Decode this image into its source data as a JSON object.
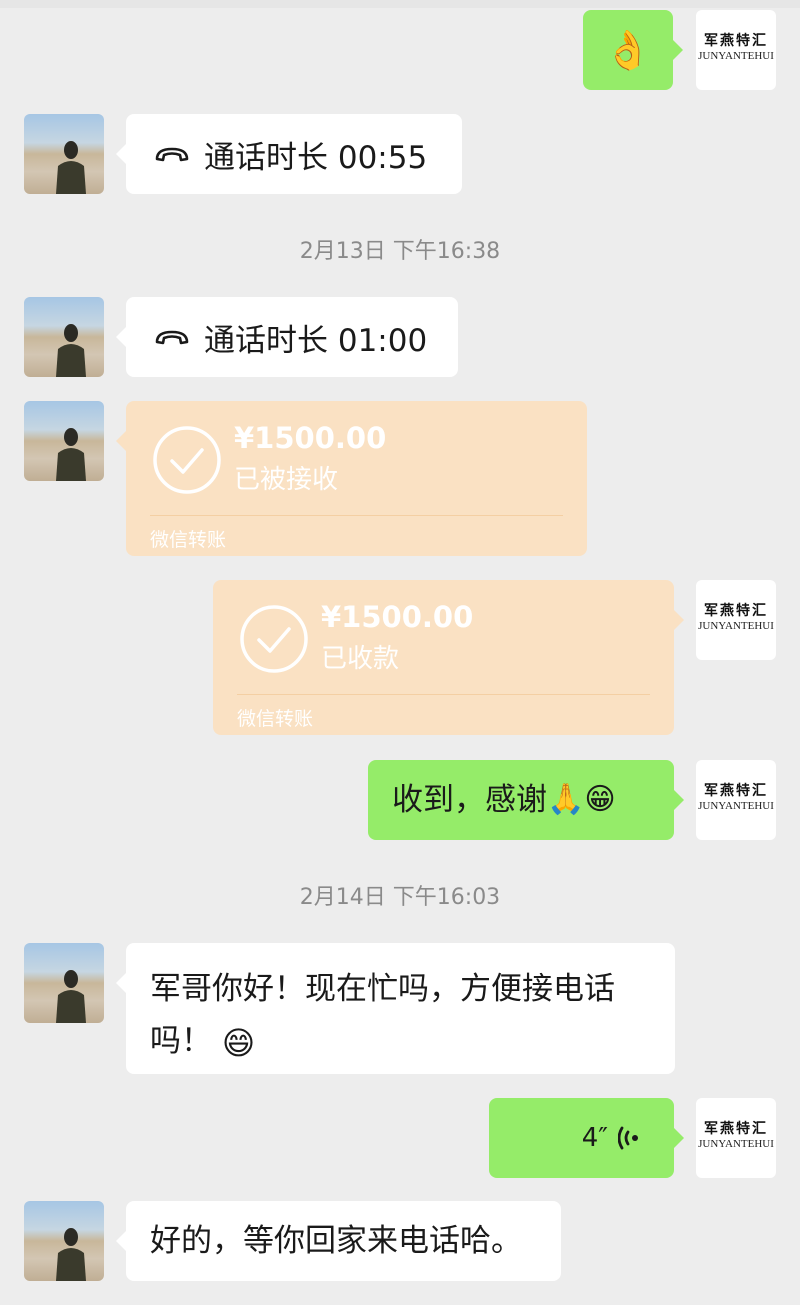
{
  "timestamps": [
    "2月13日 下午16:38",
    "2月14日 下午16:03"
  ],
  "logo": {
    "cn": "军燕特汇",
    "en": "JUNYANTEHUI"
  },
  "messages": {
    "ok_emoji": "👌",
    "call_1": {
      "label": "通话时长 00:55"
    },
    "call_2": {
      "label": "通话时长 01:00"
    },
    "transfer_1": {
      "amount": "¥1500.00",
      "status": "已被接收",
      "label": "微信转账"
    },
    "transfer_2": {
      "amount": "¥1500.00",
      "status": "已收款",
      "label": "微信转账"
    },
    "thanks": {
      "text": "收到，感谢",
      "emojis": [
        "🙏",
        "😁"
      ]
    },
    "ask": {
      "text": "军哥你好！现在忙吗，方便接电话吗！",
      "emoji": "😄"
    },
    "voice": {
      "duration": "4″"
    },
    "reply": {
      "text": "好的，等你回家来电话哈。"
    }
  },
  "icons": {
    "phone": "phone-hangup-icon",
    "check": "check-circle-icon",
    "voice": "voice-wave-icon"
  },
  "colors": {
    "background": "#ededed",
    "bubble_self": "#95ec69",
    "bubble_other": "#ffffff",
    "transfer_bg": "#fae1c3"
  }
}
